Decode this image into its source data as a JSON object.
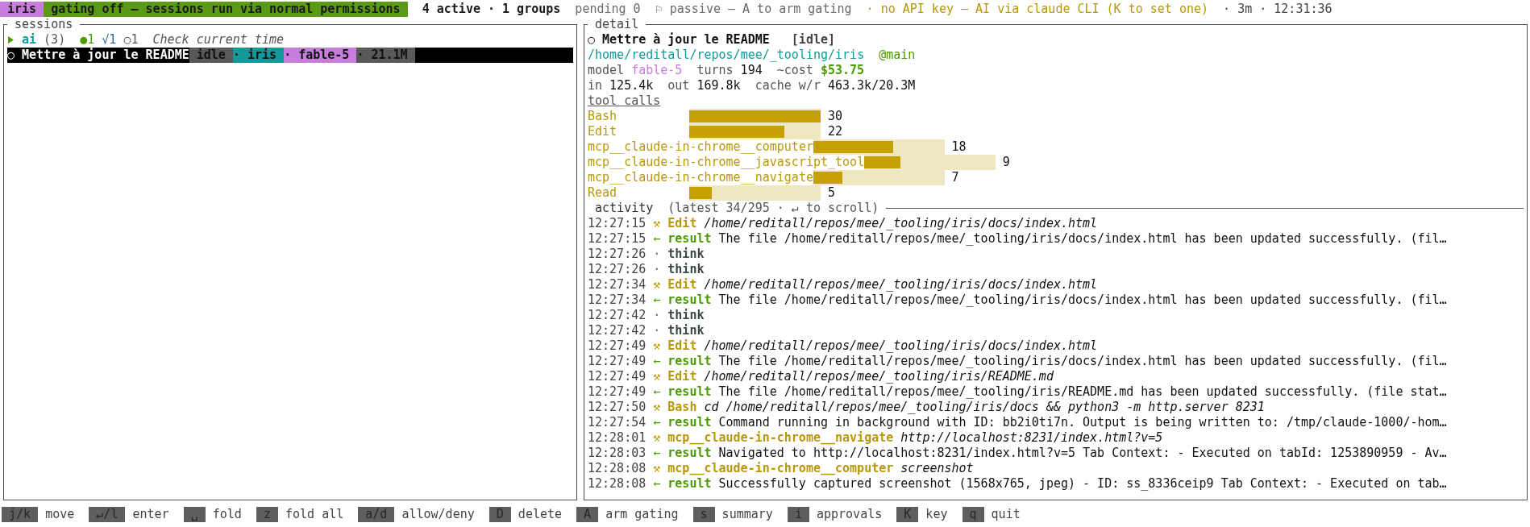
{
  "top_bar": {
    "app_badge": "iris",
    "gating_banner": "gating off – sessions run via normal permissions",
    "active_summary": "4 active · 1 groups",
    "pending": "pending 0",
    "gating_mode": "⚐ passive – A to arm gating",
    "api_notice": "· no API key – AI via claude CLI (K to set one)",
    "clock": "· 3m · 12:31:36"
  },
  "sessions": {
    "title": "sessions",
    "groups": [
      {
        "name": "ai",
        "count": "(3)",
        "expanded": false,
        "stats": [
          {
            "kind": "running",
            "text": "●1"
          },
          {
            "kind": "done",
            "text": "√1"
          },
          {
            "kind": "idle",
            "text": "○1"
          }
        ],
        "note": "Check current time"
      }
    ],
    "items": [
      {
        "marker": "○",
        "title": "Mettre à jour le README",
        "selected": true,
        "tags": [
          {
            "kind": "state",
            "text": "idle"
          },
          {
            "kind": "project",
            "text": "· iris"
          },
          {
            "kind": "model",
            "text": "· fable-5"
          },
          {
            "kind": "size",
            "text": "· 21.1M"
          }
        ]
      }
    ]
  },
  "detail": {
    "title": "detail",
    "marker": "○",
    "session_title": "Mettre à jour le README",
    "state": "[idle]",
    "path": "/home/reditall/repos/mee/_tooling/iris",
    "branch": "@main",
    "stat_lines": [
      {
        "items": [
          {
            "label": "model",
            "value": "fable-5",
            "kind": "model"
          },
          {
            "label": "turns",
            "value": "194",
            "kind": "plain"
          },
          {
            "label": "~cost",
            "value": "$53.75",
            "kind": "cost"
          }
        ]
      },
      {
        "items": [
          {
            "label": "in",
            "value": "125.4k",
            "kind": "plain"
          },
          {
            "label": "out",
            "value": "169.8k",
            "kind": "plain"
          },
          {
            "label": "cache w/r",
            "value": "463.3k/20.3M",
            "kind": "plain"
          }
        ]
      }
    ],
    "tool_calls": {
      "heading": "tool calls",
      "items": [
        {
          "name": "Bash",
          "level": 1,
          "count": "30"
        },
        {
          "name": "Edit",
          "level": 0.722,
          "count": "22"
        },
        {
          "name": "mcp__claude-in-chrome__computer",
          "level": 0.611,
          "count": "18"
        },
        {
          "name": "mcp__claude-in-chrome__javascript_tool",
          "level": 0.278,
          "count": "9"
        },
        {
          "name": "mcp__claude-in-chrome__navigate",
          "level": 0.222,
          "count": "7"
        },
        {
          "name": "Read",
          "level": 0.167,
          "count": "5"
        }
      ]
    },
    "activity": {
      "title": "activity",
      "subtitle": "(latest 34/295 · ↵ to scroll)",
      "entries": [
        {
          "time": "12:27:15",
          "kind": "tool",
          "marker": "⚒",
          "label": "Edit",
          "detail": "/home/reditall/repos/mee/_tooling/iris/docs/index.html"
        },
        {
          "time": "12:27:15",
          "kind": "result",
          "marker": "←",
          "label": "result",
          "detail": "The file /home/reditall/repos/mee/_tooling/iris/docs/index.html has been updated successfully. (fil…"
        },
        {
          "time": "12:27:26",
          "kind": "think",
          "marker": "·",
          "label": "think"
        },
        {
          "time": "12:27:26",
          "kind": "think",
          "marker": "·",
          "label": "think"
        },
        {
          "time": "12:27:34",
          "kind": "tool",
          "marker": "⚒",
          "label": "Edit",
          "detail": "/home/reditall/repos/mee/_tooling/iris/docs/index.html"
        },
        {
          "time": "12:27:34",
          "kind": "result",
          "marker": "←",
          "label": "result",
          "detail": "The file /home/reditall/repos/mee/_tooling/iris/docs/index.html has been updated successfully. (fil…"
        },
        {
          "time": "12:27:42",
          "kind": "think",
          "marker": "·",
          "label": "think"
        },
        {
          "time": "12:27:42",
          "kind": "think",
          "marker": "·",
          "label": "think"
        },
        {
          "time": "12:27:49",
          "kind": "tool",
          "marker": "⚒",
          "label": "Edit",
          "detail": "/home/reditall/repos/mee/_tooling/iris/docs/index.html"
        },
        {
          "time": "12:27:49",
          "kind": "result",
          "marker": "←",
          "label": "result",
          "detail": "The file /home/reditall/repos/mee/_tooling/iris/docs/index.html has been updated successfully. (fil…"
        },
        {
          "time": "12:27:49",
          "kind": "tool",
          "marker": "⚒",
          "label": "Edit",
          "detail": "/home/reditall/repos/mee/_tooling/iris/README.md"
        },
        {
          "time": "12:27:49",
          "kind": "result",
          "marker": "←",
          "label": "result",
          "detail": "The file /home/reditall/repos/mee/_tooling/iris/README.md has been updated successfully. (file stat…"
        },
        {
          "time": "12:27:50",
          "kind": "tool",
          "marker": "⚒",
          "label": "Bash",
          "detail": "cd /home/reditall/repos/mee/_tooling/iris/docs && python3 -m http.server 8231"
        },
        {
          "time": "12:27:54",
          "kind": "result",
          "marker": "←",
          "label": "result",
          "detail": "Command running in background with ID: bb2i0ti7n. Output is being written to: /tmp/claude-1000/-hom…"
        },
        {
          "time": "12:28:01",
          "kind": "tool",
          "marker": "⚒",
          "label": "mcp__claude-in-chrome__navigate",
          "detail": "http://localhost:8231/index.html?v=5"
        },
        {
          "time": "12:28:03",
          "kind": "result",
          "marker": "←",
          "label": "result",
          "detail": "Navigated to http://localhost:8231/index.html?v=5 Tab Context: - Executed on tabId: 1253890959 - Av…"
        },
        {
          "time": "12:28:08",
          "kind": "tool",
          "marker": "⚒",
          "label": "mcp__claude-in-chrome__computer",
          "detail": "screenshot"
        },
        {
          "time": "12:28:08",
          "kind": "result",
          "marker": "←",
          "label": "result",
          "detail": "Successfully captured screenshot (1568x765, jpeg) - ID: ss_8336ceip9 Tab Context: - Executed on tab…"
        }
      ]
    }
  },
  "key_hints": [
    {
      "key": "j/k",
      "label": "move"
    },
    {
      "key": "↵/l",
      "label": "enter"
    },
    {
      "key": "␣",
      "label": "fold"
    },
    {
      "key": "z",
      "label": "fold all"
    },
    {
      "key": "a/d",
      "label": "allow/deny"
    },
    {
      "key": "D",
      "label": "delete"
    },
    {
      "key": "A",
      "label": "arm gating"
    },
    {
      "key": "s",
      "label": "summary"
    },
    {
      "key": "i",
      "label": "approvals"
    },
    {
      "key": "K",
      "label": "key"
    },
    {
      "key": "q",
      "label": "quit"
    }
  ]
}
